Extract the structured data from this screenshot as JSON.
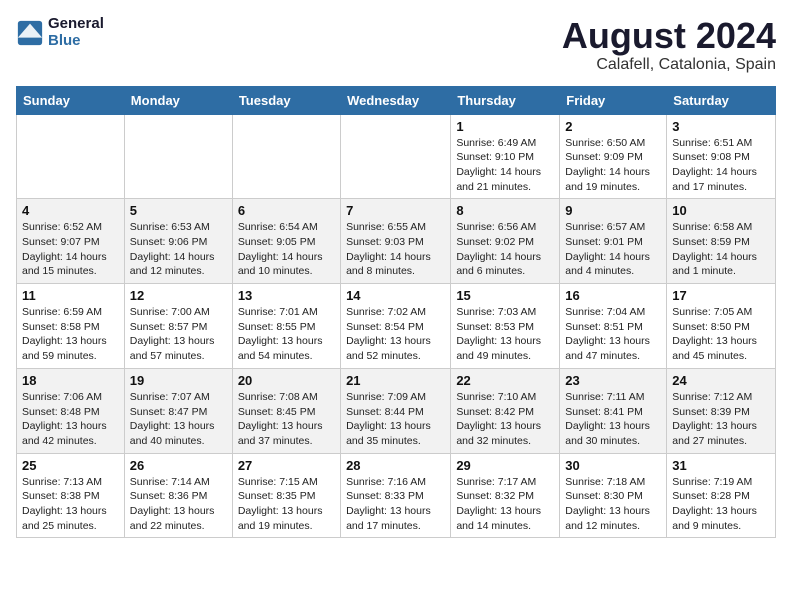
{
  "logo": {
    "line1": "General",
    "line2": "Blue"
  },
  "title": "August 2024",
  "subtitle": "Calafell, Catalonia, Spain",
  "days_of_week": [
    "Sunday",
    "Monday",
    "Tuesday",
    "Wednesday",
    "Thursday",
    "Friday",
    "Saturday"
  ],
  "weeks": [
    [
      {
        "day": "",
        "info": ""
      },
      {
        "day": "",
        "info": ""
      },
      {
        "day": "",
        "info": ""
      },
      {
        "day": "",
        "info": ""
      },
      {
        "day": "1",
        "info": "Sunrise: 6:49 AM\nSunset: 9:10 PM\nDaylight: 14 hours\nand 21 minutes."
      },
      {
        "day": "2",
        "info": "Sunrise: 6:50 AM\nSunset: 9:09 PM\nDaylight: 14 hours\nand 19 minutes."
      },
      {
        "day": "3",
        "info": "Sunrise: 6:51 AM\nSunset: 9:08 PM\nDaylight: 14 hours\nand 17 minutes."
      }
    ],
    [
      {
        "day": "4",
        "info": "Sunrise: 6:52 AM\nSunset: 9:07 PM\nDaylight: 14 hours\nand 15 minutes."
      },
      {
        "day": "5",
        "info": "Sunrise: 6:53 AM\nSunset: 9:06 PM\nDaylight: 14 hours\nand 12 minutes."
      },
      {
        "day": "6",
        "info": "Sunrise: 6:54 AM\nSunset: 9:05 PM\nDaylight: 14 hours\nand 10 minutes."
      },
      {
        "day": "7",
        "info": "Sunrise: 6:55 AM\nSunset: 9:03 PM\nDaylight: 14 hours\nand 8 minutes."
      },
      {
        "day": "8",
        "info": "Sunrise: 6:56 AM\nSunset: 9:02 PM\nDaylight: 14 hours\nand 6 minutes."
      },
      {
        "day": "9",
        "info": "Sunrise: 6:57 AM\nSunset: 9:01 PM\nDaylight: 14 hours\nand 4 minutes."
      },
      {
        "day": "10",
        "info": "Sunrise: 6:58 AM\nSunset: 8:59 PM\nDaylight: 14 hours\nand 1 minute."
      }
    ],
    [
      {
        "day": "11",
        "info": "Sunrise: 6:59 AM\nSunset: 8:58 PM\nDaylight: 13 hours\nand 59 minutes."
      },
      {
        "day": "12",
        "info": "Sunrise: 7:00 AM\nSunset: 8:57 PM\nDaylight: 13 hours\nand 57 minutes."
      },
      {
        "day": "13",
        "info": "Sunrise: 7:01 AM\nSunset: 8:55 PM\nDaylight: 13 hours\nand 54 minutes."
      },
      {
        "day": "14",
        "info": "Sunrise: 7:02 AM\nSunset: 8:54 PM\nDaylight: 13 hours\nand 52 minutes."
      },
      {
        "day": "15",
        "info": "Sunrise: 7:03 AM\nSunset: 8:53 PM\nDaylight: 13 hours\nand 49 minutes."
      },
      {
        "day": "16",
        "info": "Sunrise: 7:04 AM\nSunset: 8:51 PM\nDaylight: 13 hours\nand 47 minutes."
      },
      {
        "day": "17",
        "info": "Sunrise: 7:05 AM\nSunset: 8:50 PM\nDaylight: 13 hours\nand 45 minutes."
      }
    ],
    [
      {
        "day": "18",
        "info": "Sunrise: 7:06 AM\nSunset: 8:48 PM\nDaylight: 13 hours\nand 42 minutes."
      },
      {
        "day": "19",
        "info": "Sunrise: 7:07 AM\nSunset: 8:47 PM\nDaylight: 13 hours\nand 40 minutes."
      },
      {
        "day": "20",
        "info": "Sunrise: 7:08 AM\nSunset: 8:45 PM\nDaylight: 13 hours\nand 37 minutes."
      },
      {
        "day": "21",
        "info": "Sunrise: 7:09 AM\nSunset: 8:44 PM\nDaylight: 13 hours\nand 35 minutes."
      },
      {
        "day": "22",
        "info": "Sunrise: 7:10 AM\nSunset: 8:42 PM\nDaylight: 13 hours\nand 32 minutes."
      },
      {
        "day": "23",
        "info": "Sunrise: 7:11 AM\nSunset: 8:41 PM\nDaylight: 13 hours\nand 30 minutes."
      },
      {
        "day": "24",
        "info": "Sunrise: 7:12 AM\nSunset: 8:39 PM\nDaylight: 13 hours\nand 27 minutes."
      }
    ],
    [
      {
        "day": "25",
        "info": "Sunrise: 7:13 AM\nSunset: 8:38 PM\nDaylight: 13 hours\nand 25 minutes."
      },
      {
        "day": "26",
        "info": "Sunrise: 7:14 AM\nSunset: 8:36 PM\nDaylight: 13 hours\nand 22 minutes."
      },
      {
        "day": "27",
        "info": "Sunrise: 7:15 AM\nSunset: 8:35 PM\nDaylight: 13 hours\nand 19 minutes."
      },
      {
        "day": "28",
        "info": "Sunrise: 7:16 AM\nSunset: 8:33 PM\nDaylight: 13 hours\nand 17 minutes."
      },
      {
        "day": "29",
        "info": "Sunrise: 7:17 AM\nSunset: 8:32 PM\nDaylight: 13 hours\nand 14 minutes."
      },
      {
        "day": "30",
        "info": "Sunrise: 7:18 AM\nSunset: 8:30 PM\nDaylight: 13 hours\nand 12 minutes."
      },
      {
        "day": "31",
        "info": "Sunrise: 7:19 AM\nSunset: 8:28 PM\nDaylight: 13 hours\nand 9 minutes."
      }
    ]
  ]
}
